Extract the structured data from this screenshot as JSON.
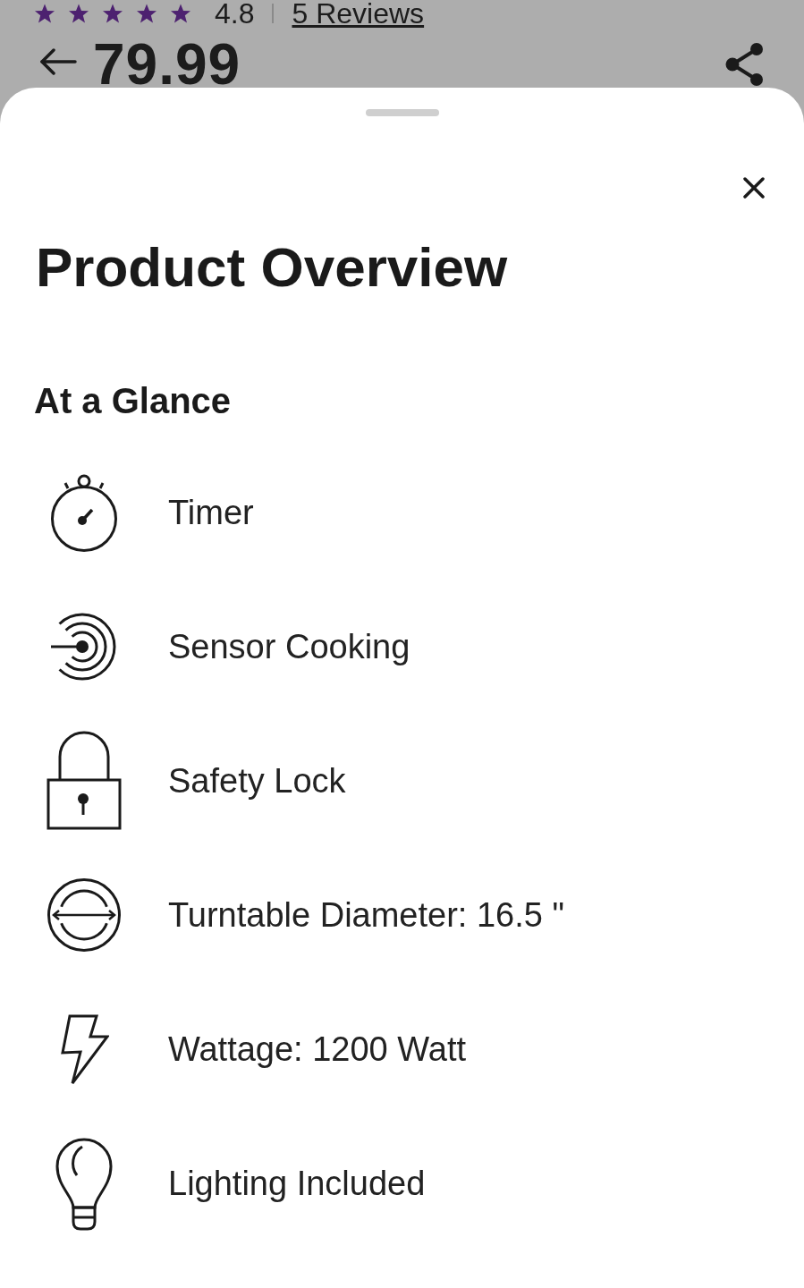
{
  "background_page": {
    "rating": {
      "stars": 5,
      "value": "4.8",
      "reviews_link": "5 Reviews"
    },
    "price": "79.99"
  },
  "sheet": {
    "title": "Product Overview",
    "section_title": "At a Glance",
    "features": [
      {
        "kind": "timer",
        "label": "Timer"
      },
      {
        "kind": "sensor",
        "label": "Sensor Cooking"
      },
      {
        "kind": "lock",
        "label": "Safety Lock"
      },
      {
        "kind": "turntable",
        "label": "Turntable Diameter: 16.5 \""
      },
      {
        "kind": "wattage",
        "label": "Wattage: 1200 Watt"
      },
      {
        "kind": "lighting",
        "label": "Lighting Included"
      }
    ]
  }
}
